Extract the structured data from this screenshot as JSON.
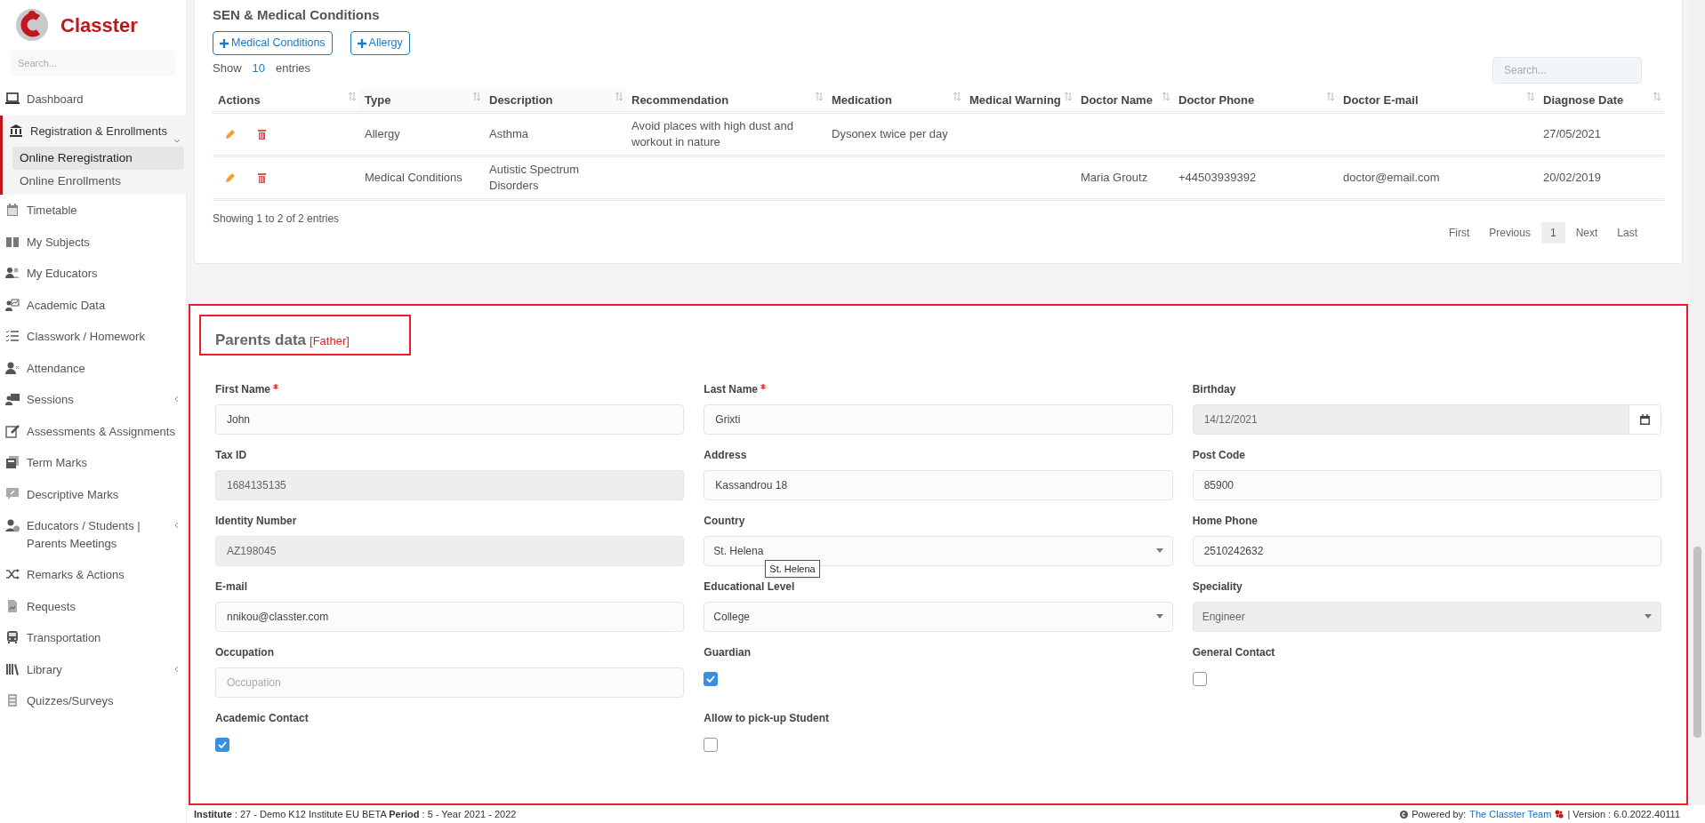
{
  "sidebar": {
    "logo": "Classter",
    "search": {
      "placeholder": "Search..."
    },
    "items": [
      {
        "label": "Dashboard",
        "expanded": false,
        "has_submenu": false
      },
      {
        "label": "Registration & Enrollments",
        "expanded": true,
        "has_submenu": true,
        "children": [
          {
            "label": "Online Reregistration",
            "selected": true
          },
          {
            "label": "Online Enrollments",
            "selected": false
          }
        ]
      },
      {
        "label": "Timetable",
        "expanded": false,
        "has_submenu": false
      },
      {
        "label": "My Subjects",
        "expanded": false,
        "has_submenu": false
      },
      {
        "label": "My Educators",
        "expanded": false,
        "has_submenu": false
      },
      {
        "label": "Academic Data",
        "expanded": false,
        "has_submenu": false
      },
      {
        "label": "Classwork / Homework",
        "expanded": false,
        "has_submenu": false
      },
      {
        "label": "Attendance",
        "expanded": false,
        "has_submenu": false
      },
      {
        "label": "Sessions",
        "expanded": false,
        "has_submenu": true
      },
      {
        "label": "Assessments & Assignments",
        "expanded": false,
        "has_submenu": false
      },
      {
        "label": "Term Marks",
        "expanded": false,
        "has_submenu": false
      },
      {
        "label": "Descriptive Marks",
        "expanded": false,
        "has_submenu": false
      },
      {
        "label": "Educators / Students | Parents Meetings",
        "expanded": false,
        "has_submenu": true
      },
      {
        "label": "Remarks & Actions",
        "expanded": false,
        "has_submenu": false
      },
      {
        "label": "Requests",
        "expanded": false,
        "has_submenu": false
      },
      {
        "label": "Transportation",
        "expanded": false,
        "has_submenu": false
      },
      {
        "label": "Library",
        "expanded": false,
        "has_submenu": true
      },
      {
        "label": "Quizzes/Surveys",
        "expanded": false,
        "has_submenu": false
      }
    ]
  },
  "medical": {
    "title": "SEN & Medical Conditions",
    "buttons": [
      "Medical Conditions",
      "Allergy"
    ],
    "length": {
      "before": "Show",
      "value": "10",
      "after": "entries"
    },
    "search": {
      "placeholder": "Search..."
    },
    "table": {
      "columns": [
        "Actions",
        "Type",
        "Description",
        "Recommendation",
        "Medication",
        "Medical Warning",
        "Doctor Name",
        "Doctor Phone",
        "Doctor E-mail",
        "Diagnose Date"
      ],
      "rows": [
        [
          "",
          "Allergy",
          "Asthma",
          "Avoid places with high dust and workout in nature",
          "Dysonex twice per day",
          "",
          "",
          "",
          "",
          "27/05/2021"
        ],
        [
          "",
          "Medical Conditions",
          "Autistic Spectrum Disorders",
          "",
          "",
          "",
          "Maria Groutz",
          "+44503939392",
          "doctor@email.com",
          "20/02/2019"
        ]
      ]
    },
    "info": "Showing 1 to 2 of 2 entries",
    "pagination": [
      {
        "label": "First",
        "selected": false
      },
      {
        "label": "Previous",
        "selected": false
      },
      {
        "label": "1",
        "selected": true
      },
      {
        "label": "Next",
        "selected": false
      },
      {
        "label": "Last",
        "selected": false
      }
    ]
  },
  "parents": {
    "title": "Parents data",
    "tag": "[Father]",
    "fields": [
      {
        "kind": "text",
        "label": "First Name",
        "required": true,
        "value": "John",
        "disabled": false
      },
      {
        "kind": "text",
        "label": "Last Name",
        "required": true,
        "value": "Grixti",
        "disabled": false
      },
      {
        "kind": "date",
        "label": "Birthday",
        "required": false,
        "value": "14/12/2021",
        "disabled": true
      },
      {
        "kind": "text",
        "label": "Tax ID",
        "required": false,
        "value": "1684135135",
        "disabled": true
      },
      {
        "kind": "text",
        "label": "Address",
        "required": false,
        "value": "Kassandrou 18",
        "disabled": false
      },
      {
        "kind": "text",
        "label": "Post Code",
        "required": false,
        "value": "85900",
        "disabled": false
      },
      {
        "kind": "text",
        "label": "Identity Number",
        "required": false,
        "value": "AZ198045",
        "disabled": true
      },
      {
        "kind": "select",
        "label": "Country",
        "required": false,
        "value": "St. Helena",
        "disabled": false,
        "tooltip": "St. Helena"
      },
      {
        "kind": "text",
        "label": "Home Phone",
        "required": false,
        "value": "2510242632",
        "disabled": false
      },
      {
        "kind": "text",
        "label": "E-mail",
        "required": false,
        "value": "nnikou@classter.com",
        "disabled": false
      },
      {
        "kind": "select",
        "label": "Educational Level",
        "required": false,
        "value": "College",
        "disabled": false
      },
      {
        "kind": "select",
        "label": "Speciality",
        "required": false,
        "value": "Engineer",
        "disabled": true
      },
      {
        "kind": "text",
        "label": "Occupation",
        "required": false,
        "placeholder": "Occupation",
        "disabled": false
      },
      {
        "kind": "checkbox",
        "label": "Guardian",
        "checked": true
      },
      {
        "kind": "checkbox",
        "label": "General Contact",
        "checked": false
      },
      {
        "kind": "checkbox",
        "label": "Academic Contact",
        "checked": true
      },
      {
        "kind": "checkbox",
        "label": "Allow to pick-up Student",
        "checked": false
      }
    ]
  },
  "footer": {
    "left": "**Institute** : 27 - Demo K12 Institute EU BETA **Period** : 5 - Year 2021 - 2022",
    "powered": "Powered by:",
    "team": "The Classter Team",
    "version": "| Version : 6.0.2022.40111"
  }
}
